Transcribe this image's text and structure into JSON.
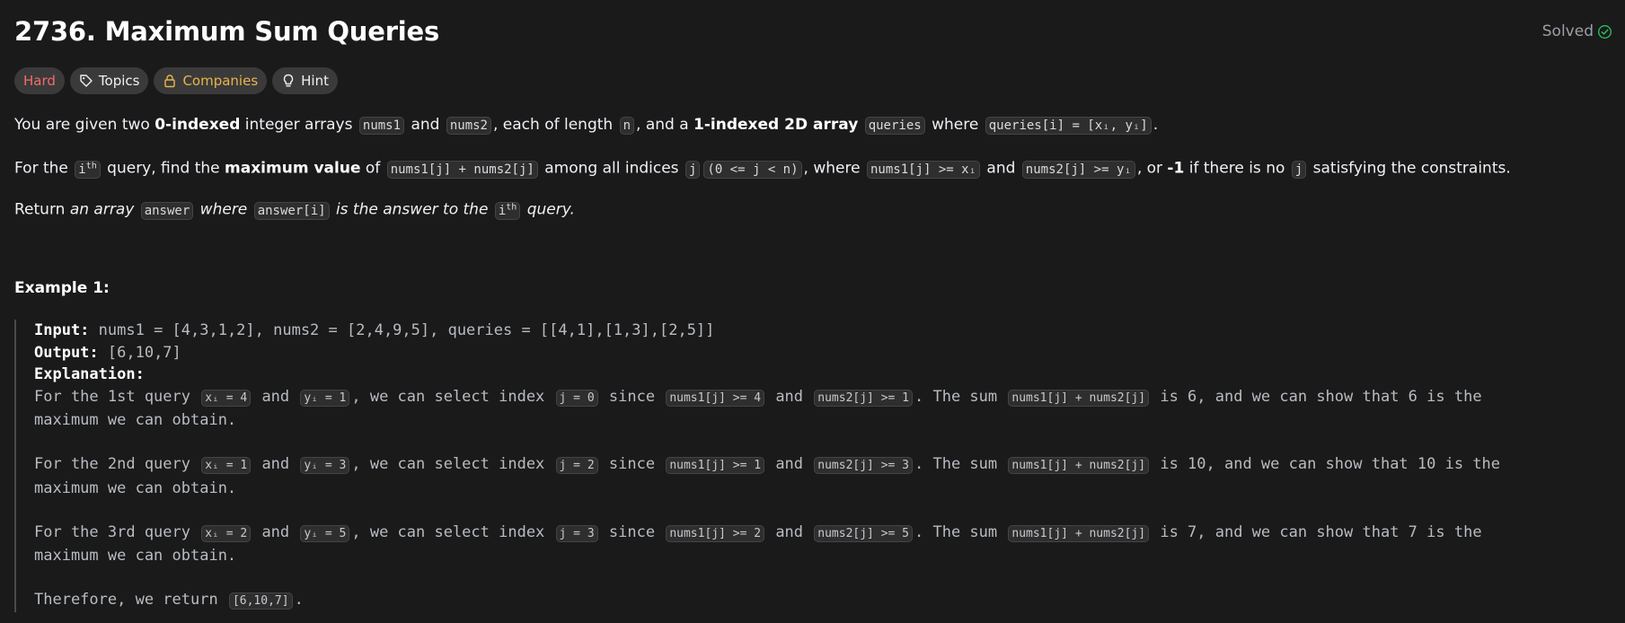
{
  "title": "2736. Maximum Sum Queries",
  "status": {
    "label": "Solved",
    "icon": "check-circle-icon",
    "color": "#2cbb5d"
  },
  "tags": {
    "difficulty": "Hard",
    "topics": "Topics",
    "companies": "Companies",
    "hint": "Hint"
  },
  "p1": {
    "t1": "You are given two ",
    "b1": "0-indexed",
    "t2": " integer arrays ",
    "c1": "nums1",
    "t3": " and ",
    "c2": "nums2",
    "t4": ", each of length ",
    "c3": "n",
    "t5": ", and a ",
    "b2": "1-indexed 2D array",
    "t6": " ",
    "c4": "queries",
    "t7": " where ",
    "c5": "queries[i] = [xᵢ, yᵢ]",
    "t8": "."
  },
  "p2": {
    "t1": "For the ",
    "c1": "i",
    "c1sup": "th",
    "t2": " query, find the ",
    "b1": "maximum value",
    "t3": " of ",
    "c2": "nums1[j] + nums2[j]",
    "t4": " among all indices ",
    "c3": "j",
    "c4": "(0 <= j < n)",
    "t5": ", where ",
    "c5": "nums1[j] >= xᵢ",
    "t6": " and ",
    "c6": "nums2[j] >= yᵢ",
    "t7": ", or ",
    "b2": "-1",
    "t8": " if there is no ",
    "c7": "j",
    "t9": " satisfying the constraints."
  },
  "p3": {
    "t1": "Return ",
    "i1": "an array ",
    "c1": "answer",
    "i2": " where ",
    "c2": "answer[i]",
    "i3": " is the answer to the ",
    "c3": "i",
    "c3sup": "th",
    "i4": " query."
  },
  "example": {
    "title": "Example 1:",
    "input_label": "Input:",
    "input_value": " nums1 = [4,3,1,2], nums2 = [2,4,9,5], queries = [[4,1],[1,3],[2,5]]",
    "output_label": "Output:",
    "output_value": " [6,10,7]",
    "explanation_label": "Explanation:",
    "q1": {
      "a": "For the 1st query ",
      "x": "xᵢ = 4",
      "and1": " and ",
      "y": "yᵢ = 1",
      "b": ", we can select index ",
      "j": "j = 0",
      "since": " since ",
      "n1": "nums1[j] >= 4",
      "and2": " and ",
      "n2": "nums2[j] >= 1",
      "sum": ". The sum ",
      "s": "nums1[j] + nums2[j]",
      "tail": " is 6, and we can show that 6 is the",
      "line2": "maximum we can obtain."
    },
    "q2": {
      "a": "For the 2nd query ",
      "x": "xᵢ = 1",
      "and1": " and ",
      "y": "yᵢ = 3",
      "b": ", we can select index ",
      "j": "j = 2",
      "since": " since ",
      "n1": "nums1[j] >= 1",
      "and2": " and ",
      "n2": "nums2[j] >= 3",
      "sum": ". The sum ",
      "s": "nums1[j] + nums2[j]",
      "tail": " is 10, and we can show that 10 is the",
      "line2": "maximum we can obtain."
    },
    "q3": {
      "a": "For the 3rd query ",
      "x": "xᵢ = 2",
      "and1": " and ",
      "y": "yᵢ = 5",
      "b": ", we can select index ",
      "j": "j = 3",
      "since": " since ",
      "n1": "nums1[j] >= 2",
      "and2": " and ",
      "n2": "nums2[j] >= 5",
      "sum": ". The sum ",
      "s": "nums1[j] + nums2[j]",
      "tail": " is 7, and we can show that 7 is the",
      "line2": "maximum we can obtain."
    },
    "therefore": "Therefore, we return ",
    "result": "[6,10,7]",
    "period": "."
  }
}
